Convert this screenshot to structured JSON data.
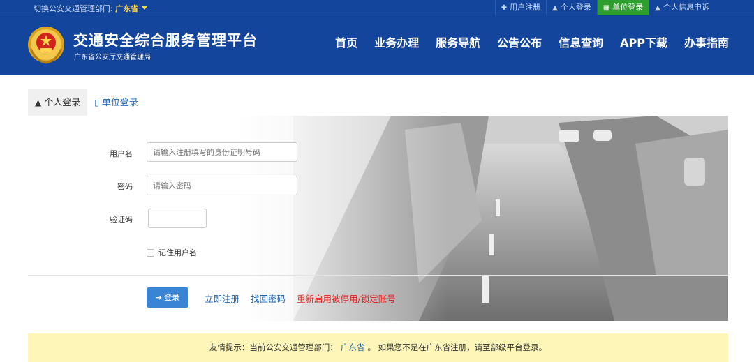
{
  "topbar": {
    "dept_label": "切换公安交通管理部门:",
    "dept_value": "广东省",
    "links": [
      {
        "icon": "plus-icon",
        "glyph": "✚",
        "label": "用户注册"
      },
      {
        "icon": "person-icon",
        "glyph": "▲",
        "label": "个人登录"
      },
      {
        "icon": "building-icon",
        "glyph": "▦",
        "label": "单位登录",
        "active": true
      },
      {
        "icon": "person-icon",
        "glyph": "▲",
        "label": "个人信息申诉"
      }
    ]
  },
  "header": {
    "title": "交通安全综合服务管理平台",
    "subtitle": "广东省公安厅交通管理局",
    "nav": [
      "首页",
      "业务办理",
      "服务导航",
      "公告公布",
      "信息查询",
      "APP下载",
      "办事指南"
    ]
  },
  "tabs": {
    "personal": "个人登录",
    "company": "单位登录"
  },
  "form": {
    "username_label": "用户名",
    "username_placeholder": "请输入注册填写的身份证明号码",
    "password_label": "密码",
    "password_placeholder": "请输入密码",
    "captcha_label": "验证码",
    "remember_label": "记住用户名",
    "login_label": "登录",
    "register_link": "立即注册",
    "recover_link": "找回密码",
    "unlock_link": "重新启用被停用/锁定账号"
  },
  "notice": {
    "prefix": "友情提示：当前公安交通管理部门：",
    "dept": "广东省",
    "suffix": "。 如果您不是在广东省注册，请至部级平台登录。"
  },
  "colors": {
    "header_bg": "#12459b",
    "active_green": "#2e9e2e",
    "primary_button": "#3a84d6",
    "link_blue": "#1a5fb0",
    "warning_red": "#e02020",
    "notice_bg": "#fdf6b8"
  }
}
